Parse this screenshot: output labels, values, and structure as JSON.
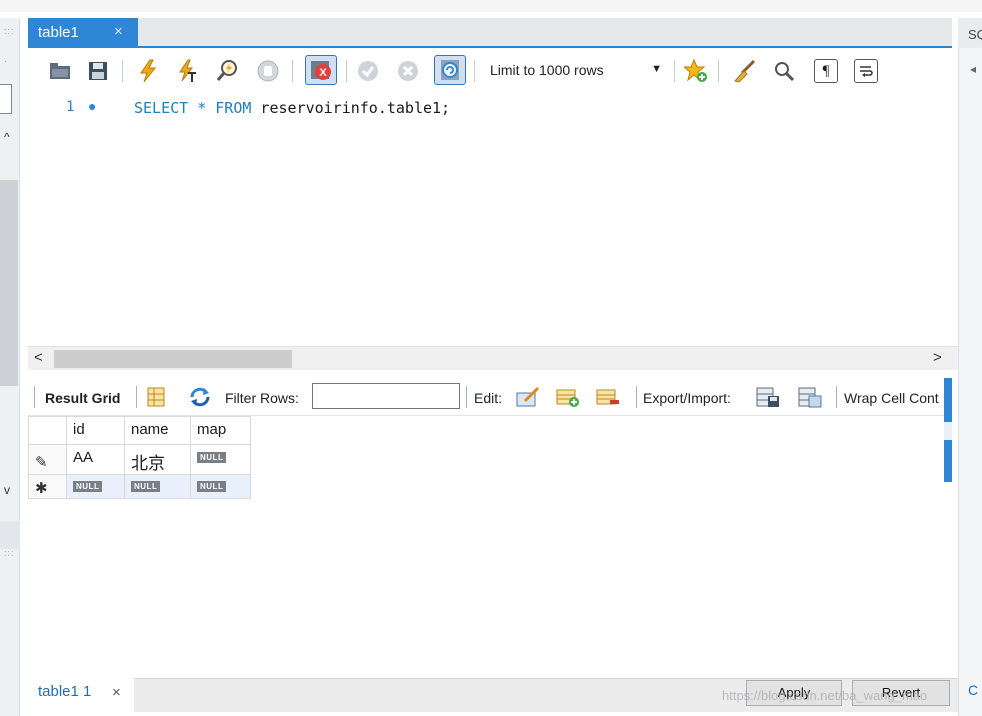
{
  "window": {
    "editor_tab": {
      "label": "table1",
      "close_glyph": "×"
    },
    "right_panel_label": "SQL",
    "right_panel_bottom_label": "C"
  },
  "toolbar": {
    "limit_select": {
      "selected": "Limit to 1000 rows"
    },
    "icons": [
      "open-folder-icon",
      "save-icon",
      "execute-lightning-icon",
      "execute-cursor-icon",
      "explain-magnifier-icon",
      "stop-hand-icon",
      "toggle-stop-on-error-icon",
      "commit-check-icon",
      "rollback-x-icon",
      "autocommit-icon",
      "add-snippet-star-icon",
      "beautify-brush-icon",
      "find-magnifier-icon",
      "invisible-chars-icon",
      "wrap-lines-icon"
    ]
  },
  "editor": {
    "line_number": "1",
    "sql_keyword_select": "SELECT",
    "sql_star": " * ",
    "sql_keyword_from": "FROM",
    "sql_rest": " reservoirinfo.table1;"
  },
  "result_toolbar": {
    "result_grid_label": "Result Grid",
    "filter_rows_label": "Filter Rows:",
    "filter_value": "",
    "edit_label": "Edit:",
    "export_import_label": "Export/Import:",
    "wrap_cell_label": "Wrap Cell Cont"
  },
  "grid": {
    "columns": [
      "id",
      "name",
      "map"
    ],
    "rows": [
      {
        "marker": "✎",
        "cells": [
          "AA",
          "北京",
          "NULL"
        ]
      }
    ],
    "new_row": {
      "marker": "✱",
      "cells": [
        "NULL",
        "NULL",
        "NULL"
      ]
    }
  },
  "bottom": {
    "result_tab_label": "table1 1",
    "result_tab_close": "×",
    "apply_label": "Apply",
    "revert_label": "Revert"
  },
  "watermark": "https://blog.csdn.net/ba_wang_mao",
  "colors": {
    "accent": "#2f86d6",
    "keyword": "#1e7fc2",
    "null_badge": "#787f87",
    "new_row_bg": "#e7f0fb"
  }
}
